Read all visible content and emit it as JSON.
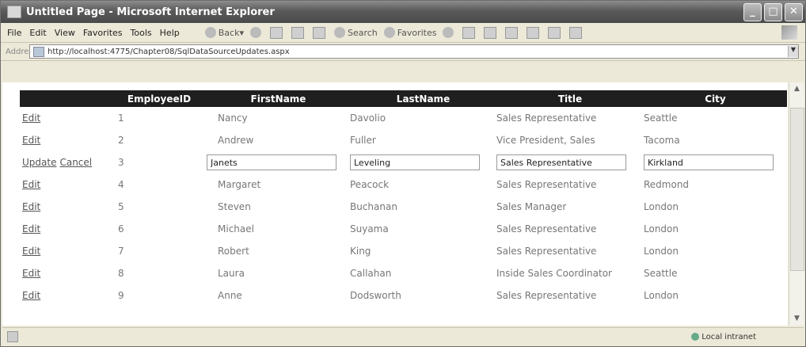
{
  "window": {
    "title": "Untitled Page - Microsoft Internet Explorer",
    "controls": [
      "_",
      "□",
      "✕"
    ]
  },
  "menu": [
    "File",
    "Edit",
    "View",
    "Favorites",
    "Tools",
    "Help"
  ],
  "toolbar": {
    "back": "Back",
    "search": "Search",
    "favorites": "Favorites"
  },
  "address": {
    "label": "Address",
    "url": "http://localhost:4775/Chapter08/SqlDataSourceUpdates.aspx"
  },
  "grid": {
    "columns": [
      "",
      "EmployeeID",
      "FirstName",
      "LastName",
      "Title",
      "City"
    ],
    "rows": [
      {
        "actions": [
          "Edit"
        ],
        "id": "1",
        "first": "Nancy",
        "last": "Davolio",
        "title": "Sales Representative",
        "city": "Seattle"
      },
      {
        "actions": [
          "Edit"
        ],
        "id": "2",
        "first": "Andrew",
        "last": "Fuller",
        "title": "Vice President, Sales",
        "city": "Tacoma"
      },
      {
        "actions": [
          "Update",
          "Cancel"
        ],
        "id": "3",
        "first": "Janets",
        "last": "Leveling",
        "title": "Sales Representative",
        "city": "Kirkland",
        "editing": true
      },
      {
        "actions": [
          "Edit"
        ],
        "id": "4",
        "first": "Margaret",
        "last": "Peacock",
        "title": "Sales Representative",
        "city": "Redmond"
      },
      {
        "actions": [
          "Edit"
        ],
        "id": "5",
        "first": "Steven",
        "last": "Buchanan",
        "title": "Sales Manager",
        "city": "London"
      },
      {
        "actions": [
          "Edit"
        ],
        "id": "6",
        "first": "Michael",
        "last": "Suyama",
        "title": "Sales Representative",
        "city": "London"
      },
      {
        "actions": [
          "Edit"
        ],
        "id": "7",
        "first": "Robert",
        "last": "King",
        "title": "Sales Representative",
        "city": "London"
      },
      {
        "actions": [
          "Edit"
        ],
        "id": "8",
        "first": "Laura",
        "last": "Callahan",
        "title": "Inside Sales Coordinator",
        "city": "Seattle"
      },
      {
        "actions": [
          "Edit"
        ],
        "id": "9",
        "first": "Anne",
        "last": "Dodsworth",
        "title": "Sales Representative",
        "city": "London"
      }
    ]
  },
  "status": {
    "zone": "Local intranet"
  }
}
